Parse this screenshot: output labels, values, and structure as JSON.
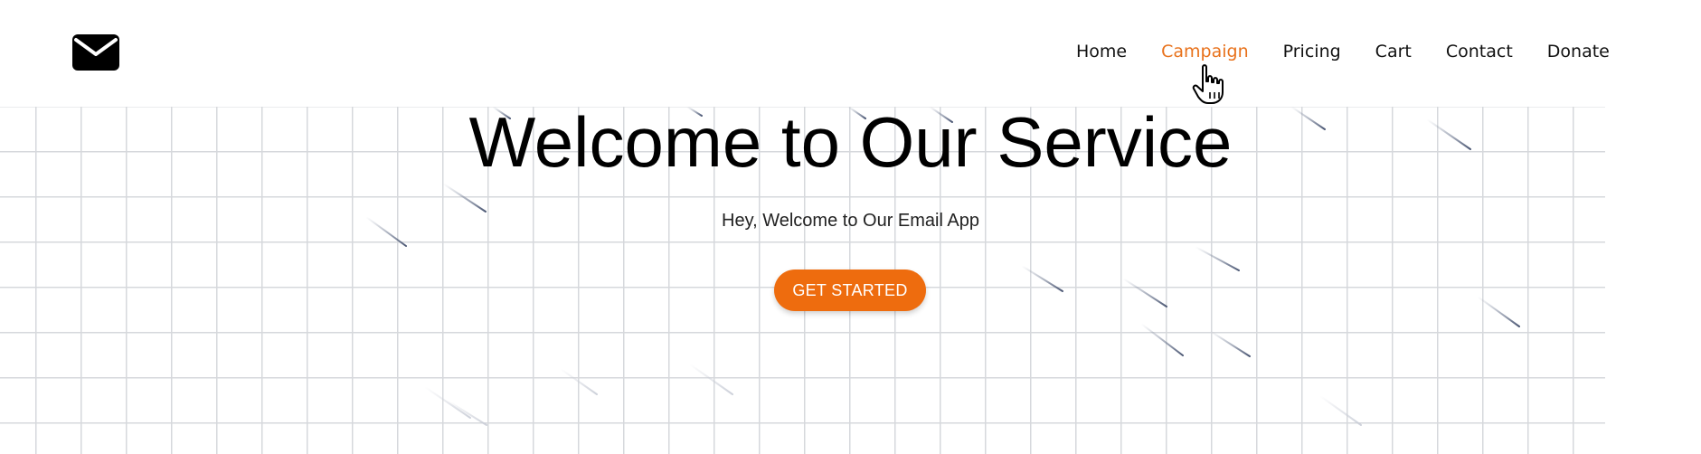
{
  "navbar": {
    "logo_icon": "envelope-icon",
    "links": [
      {
        "label": "Home",
        "active": false
      },
      {
        "label": "Campaign",
        "active": true
      },
      {
        "label": "Pricing",
        "active": false
      },
      {
        "label": "Cart",
        "active": false
      },
      {
        "label": "Contact",
        "active": false
      },
      {
        "label": "Donate",
        "active": false
      }
    ],
    "active_color": "#e8721c"
  },
  "cursor": {
    "icon": "hand-pointer-icon"
  },
  "hero": {
    "title": "Welcome to Our Service",
    "subtitle": "Hey, Welcome to Our Email App",
    "cta_label": "GET STARTED",
    "cta_color": "#ee6c0e",
    "background": "grid-with-falling-streaks"
  }
}
